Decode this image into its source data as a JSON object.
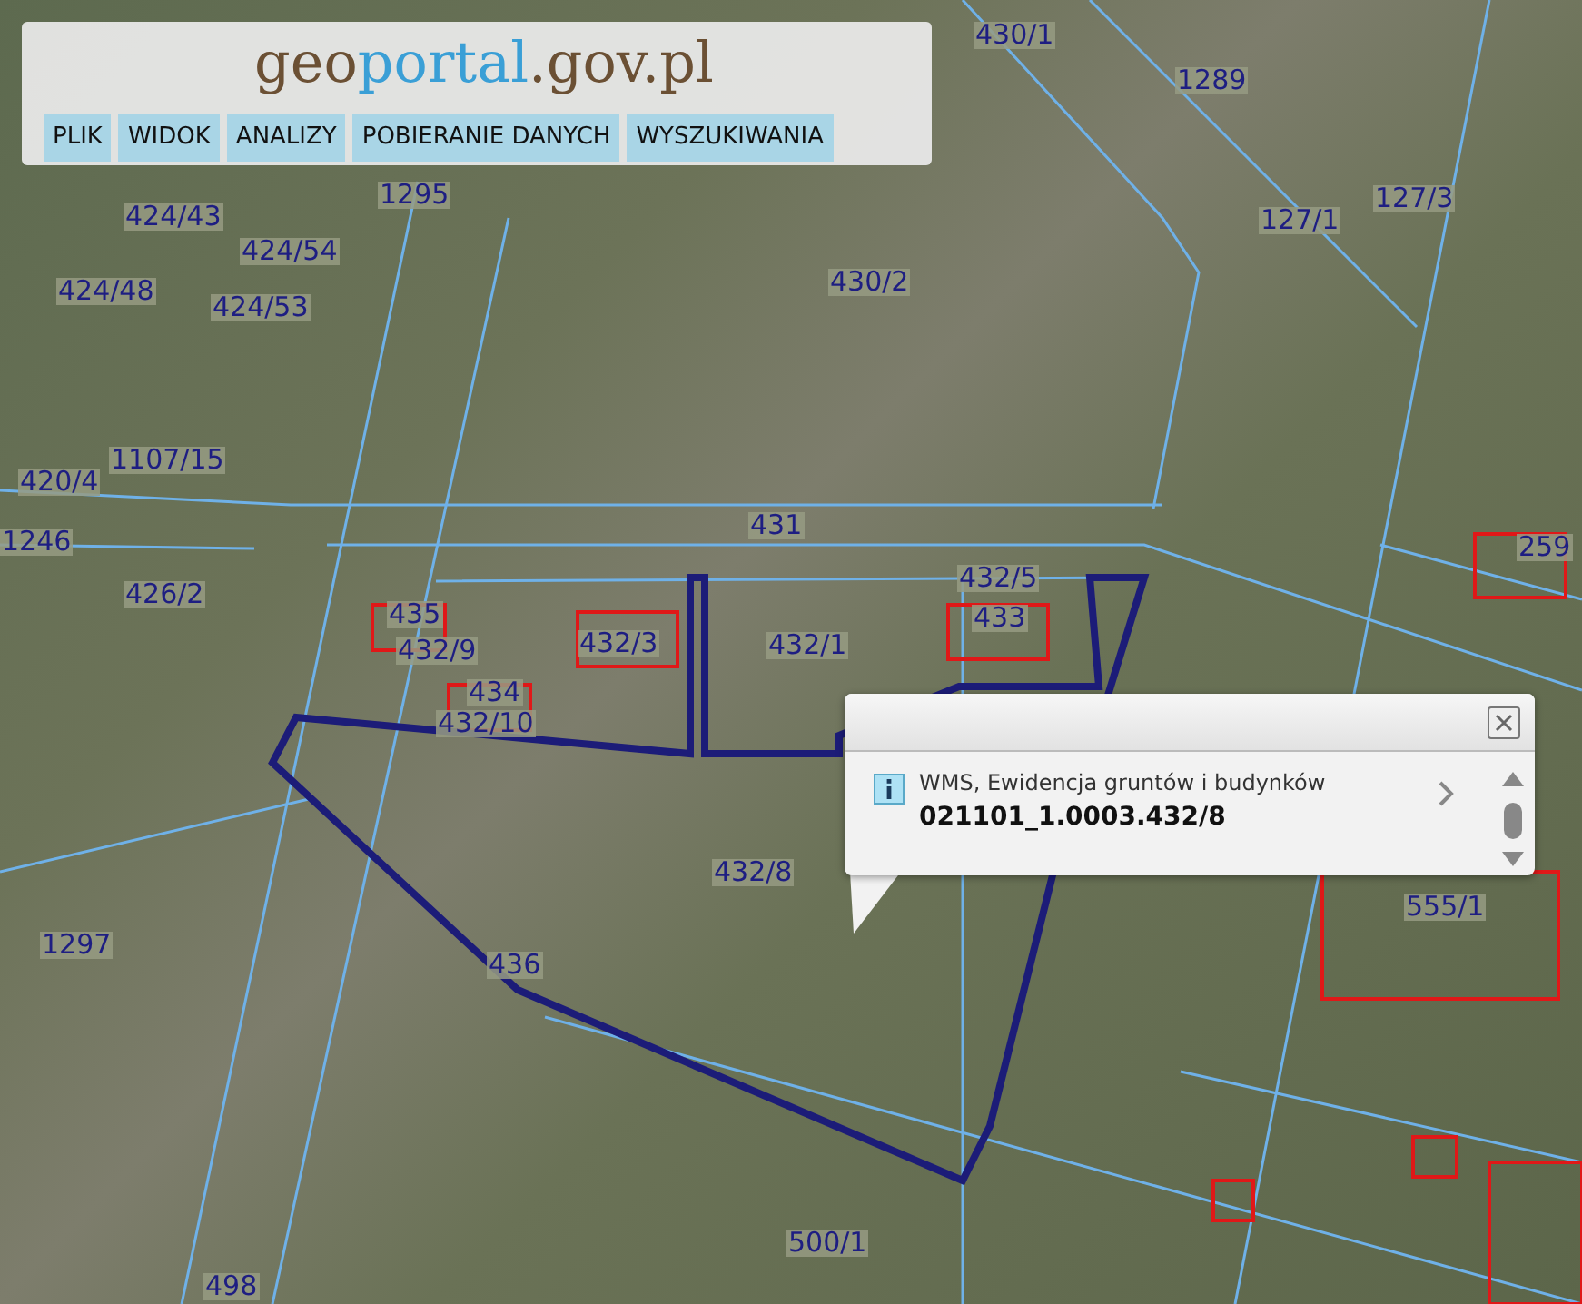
{
  "header": {
    "logo": [
      {
        "text": "geo",
        "color": "#6b5034"
      },
      {
        "text": "portal",
        "color": "#3a9fd6"
      },
      {
        "text": ".gov.pl",
        "color": "#6b5034"
      }
    ],
    "menu": [
      "PLIK",
      "WIDOK",
      "ANALIZY",
      "POBIERANIE DANYCH",
      "WYSZUKIWANIA"
    ]
  },
  "map": {
    "parcel_labels": [
      "430/1",
      "1289",
      "1295",
      "127/1",
      "127/3",
      "430/2",
      "424/43",
      "424/54",
      "424/53",
      "424/48",
      "1107/15",
      "420/4",
      "1246",
      "426/2",
      "431",
      "259",
      "432/5",
      "433",
      "435",
      "432/9",
      "432/3",
      "432/1",
      "434",
      "432/10",
      "432/8",
      "555/1",
      "1297",
      "436",
      "500/1",
      "498"
    ]
  },
  "popup": {
    "source": "WMS, Ewidencja gruntów i budynków",
    "identifier": "021101_1.0003.432/8"
  }
}
